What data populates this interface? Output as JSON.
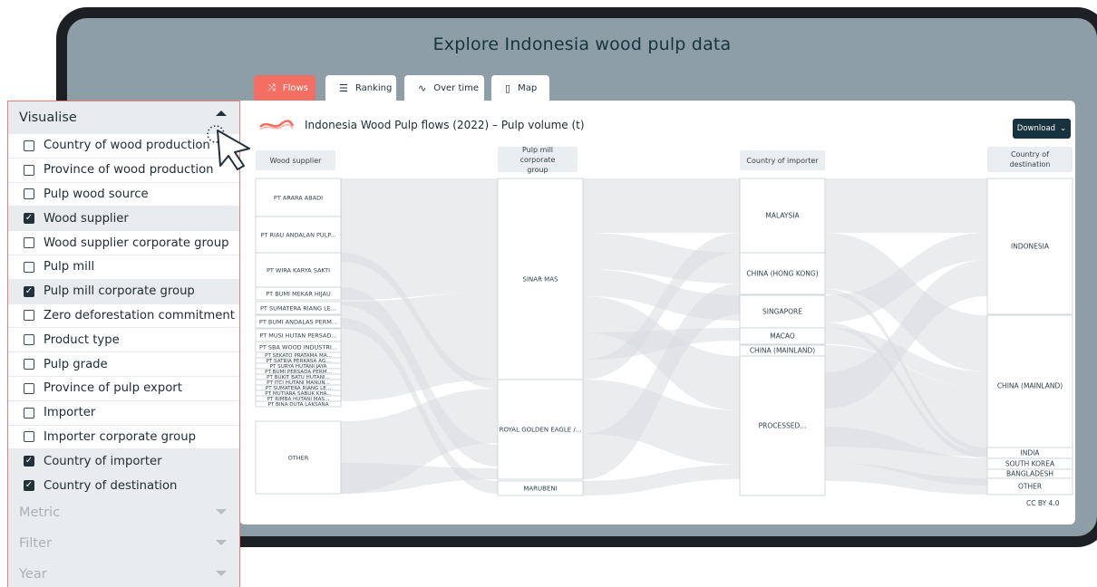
{
  "app": {
    "title": "Explore Indonesia wood pulp data"
  },
  "tabs": [
    {
      "label": "Flows",
      "icon": "flows-icon",
      "active": true
    },
    {
      "label": "Ranking",
      "icon": "ranking-icon",
      "active": false
    },
    {
      "label": "Over time",
      "icon": "trend-icon",
      "active": false
    },
    {
      "label": "Map",
      "icon": "map-icon",
      "active": false
    }
  ],
  "chart": {
    "title": "Indonesia Wood Pulp flows (2022) – Pulp volume (t)",
    "download_label": "Download",
    "license": "CC BY 4.0",
    "columns": [
      {
        "header": "Wood supplier",
        "nodes": [
          "PT ARARA ABADI",
          "PT RIAU ANDALAN PULP...",
          "PT WIRA KARYA SAKTI",
          "PT BUMI MEKAR HIJAU",
          "PT SUMATERA RIANG LE...",
          "PT BUMI ANDALAS PERM...",
          "PT MUSI HUTAN PERSAD...",
          "PT SBA WOOD INDUSTRI...",
          "PT SEKATO PRATAMA MA...",
          "PT SATRIA PERKASA AG...",
          "PT SURYA HUTANI JAYA",
          "PT BUMI PERSADA PERM...",
          "PT BUKIT BATU HUTANI...",
          "PT ITCI HUTANI MANUN...",
          "PT SUMATERA RIANG LE...",
          "PT MUTIARA SABUK KHA...",
          "PT RIMBA HUTANI MAS...",
          "PT BINA DUTA LAKSANA",
          "OTHER"
        ]
      },
      {
        "header": "Pulp mill corporate group",
        "nodes": [
          "SINAR MAS",
          "ROYAL GOLDEN EAGLE /...",
          "MARUBENI"
        ]
      },
      {
        "header": "Country of importer",
        "nodes": [
          "MALAYSIA",
          "CHINA (HONG KONG)",
          "SINGAPORE",
          "MACAO",
          "CHINA (MAINLAND)",
          "PROCESSED..."
        ]
      },
      {
        "header": "Country of destination",
        "nodes": [
          "INDONESIA",
          "CHINA (MAINLAND)",
          "INDIA",
          "SOUTH KOREA",
          "BANGLADESH",
          "OTHER"
        ]
      }
    ]
  },
  "sidebar": {
    "visualise": {
      "title": "Visualise",
      "options": [
        {
          "label": "Country of wood production",
          "checked": false
        },
        {
          "label": "Province of wood production",
          "checked": false
        },
        {
          "label": "Pulp wood source",
          "checked": false
        },
        {
          "label": "Wood supplier",
          "checked": true
        },
        {
          "label": "Wood supplier corporate group",
          "checked": false
        },
        {
          "label": "Pulp mill",
          "checked": false
        },
        {
          "label": "Pulp mill corporate group",
          "checked": true
        },
        {
          "label": "Zero deforestation commitment",
          "checked": false
        },
        {
          "label": "Product type",
          "checked": false
        },
        {
          "label": "Pulp grade",
          "checked": false
        },
        {
          "label": "Province of pulp export",
          "checked": false
        },
        {
          "label": "Importer",
          "checked": false
        },
        {
          "label": "Importer corporate group",
          "checked": false
        },
        {
          "label": "Country of importer",
          "checked": true
        },
        {
          "label": "Country of destination",
          "checked": true
        }
      ]
    },
    "metric": {
      "title": "Metric"
    },
    "filter": {
      "title": "Filter"
    },
    "year": {
      "title": "Year"
    }
  },
  "colors": {
    "accent": "#f46f63",
    "navy": "#17333f",
    "frame": "#1c1f23",
    "screen": "#8e9ea6",
    "flow": "#d9dde0"
  }
}
